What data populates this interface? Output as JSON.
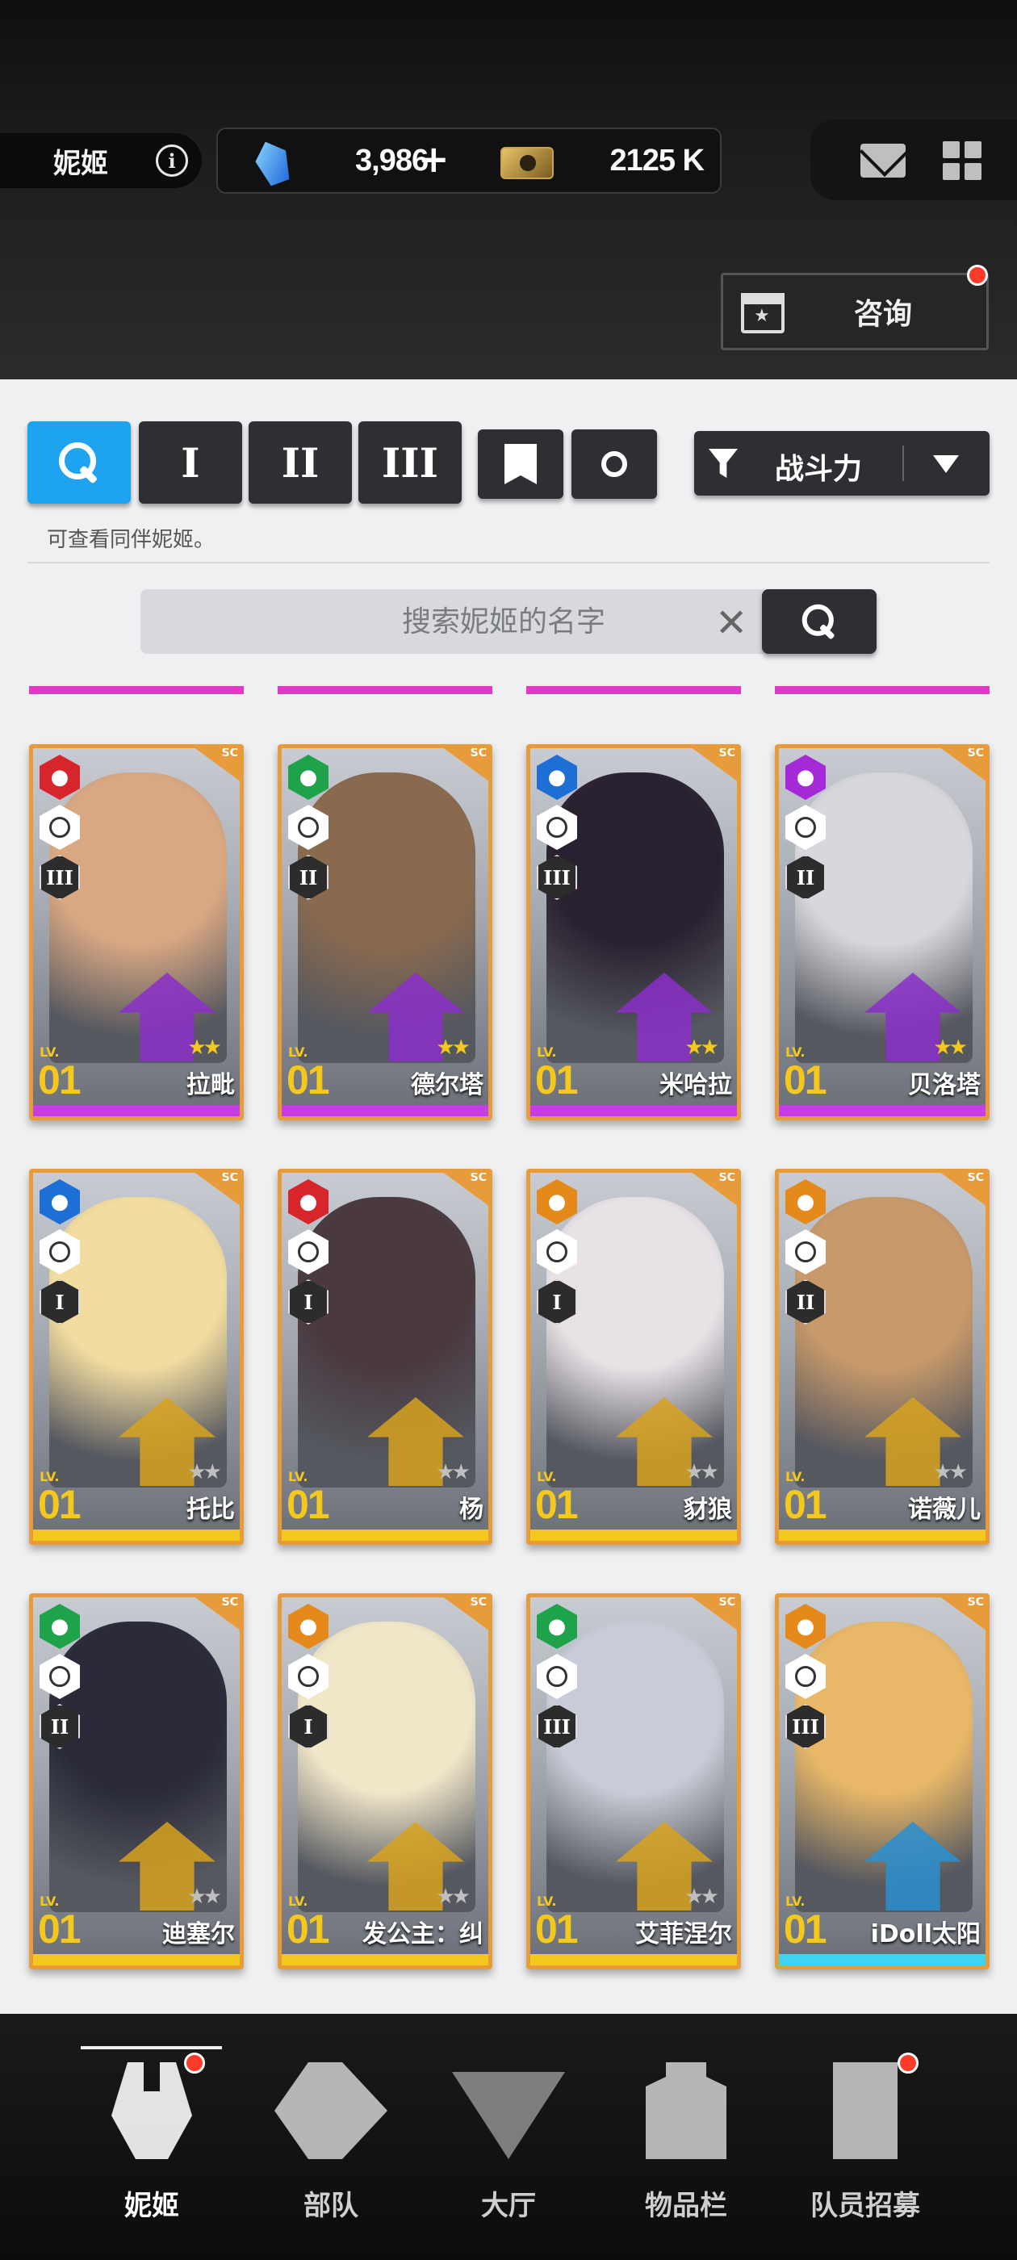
{
  "header": {
    "player_name": "妮姬",
    "gems": "3,986",
    "gem_add": "+",
    "credits": "2125 K",
    "consult_label": "咨询"
  },
  "filters": {
    "burst_1": "I",
    "burst_2": "II",
    "burst_3": "III",
    "sort_label": "战斗力",
    "hint": "可查看同伴妮姬。"
  },
  "search": {
    "placeholder": "搜索妮姬的名字",
    "clear": "✕"
  },
  "colors": {
    "accent_blue": "#1da3f0",
    "card_border": "#e79b3a",
    "ssr_bar": "#c43de6",
    "sr_bar": "#f4c81d",
    "r_bar": "#3fd3f3"
  },
  "cards": [
    {
      "name": "拉毗",
      "level": "01",
      "lv_label": "LV.",
      "element": "fire-icon",
      "burst": "III",
      "rarity": "SSR",
      "stars": "★★"
    },
    {
      "name": "德尔塔",
      "level": "01",
      "lv_label": "LV.",
      "element": "wind-icon",
      "burst": "II",
      "rarity": "SSR",
      "stars": "★★"
    },
    {
      "name": "米哈拉",
      "level": "01",
      "lv_label": "LV.",
      "element": "water-icon",
      "burst": "III",
      "rarity": "SSR",
      "stars": "★★"
    },
    {
      "name": "贝洛塔",
      "level": "01",
      "lv_label": "LV.",
      "element": "electric-icon",
      "burst": "II",
      "rarity": "SSR",
      "stars": "★★"
    },
    {
      "name": "托比",
      "level": "01",
      "lv_label": "LV.",
      "element": "water-icon",
      "burst": "I",
      "rarity": "SR",
      "stars": "★★"
    },
    {
      "name": "杨",
      "level": "01",
      "lv_label": "LV.",
      "element": "fire-icon",
      "burst": "I",
      "rarity": "SR",
      "stars": "★★"
    },
    {
      "name": "豺狼",
      "level": "01",
      "lv_label": "LV.",
      "element": "iron-icon",
      "burst": "I",
      "rarity": "SR",
      "stars": "★★"
    },
    {
      "name": "诺薇儿",
      "level": "01",
      "lv_label": "LV.",
      "element": "iron-icon",
      "burst": "II",
      "rarity": "SR",
      "stars": "★★"
    },
    {
      "name": "迪塞尔",
      "level": "01",
      "lv_label": "LV.",
      "element": "wind-icon",
      "burst": "II",
      "rarity": "SR",
      "stars": "★★"
    },
    {
      "name": "发公主：纠",
      "level": "01",
      "lv_label": "LV.",
      "element": "iron-icon",
      "burst": "I",
      "rarity": "SR",
      "stars": "★★"
    },
    {
      "name": "艾菲涅尔",
      "level": "01",
      "lv_label": "LV.",
      "element": "wind-icon",
      "burst": "III",
      "rarity": "SR",
      "stars": "★★"
    },
    {
      "name": "iDoll太阳",
      "level": "01",
      "lv_label": "LV.",
      "element": "iron-icon",
      "burst": "III",
      "rarity": "R",
      "stars": ""
    }
  ],
  "nav": [
    {
      "label": "妮姬",
      "icon": "nikke-icon"
    },
    {
      "label": "部队",
      "icon": "squad-icon"
    },
    {
      "label": "大厅",
      "icon": "lobby-icon"
    },
    {
      "label": "物品栏",
      "icon": "inventory-icon"
    },
    {
      "label": "队员招募",
      "icon": "recruit-icon"
    }
  ]
}
